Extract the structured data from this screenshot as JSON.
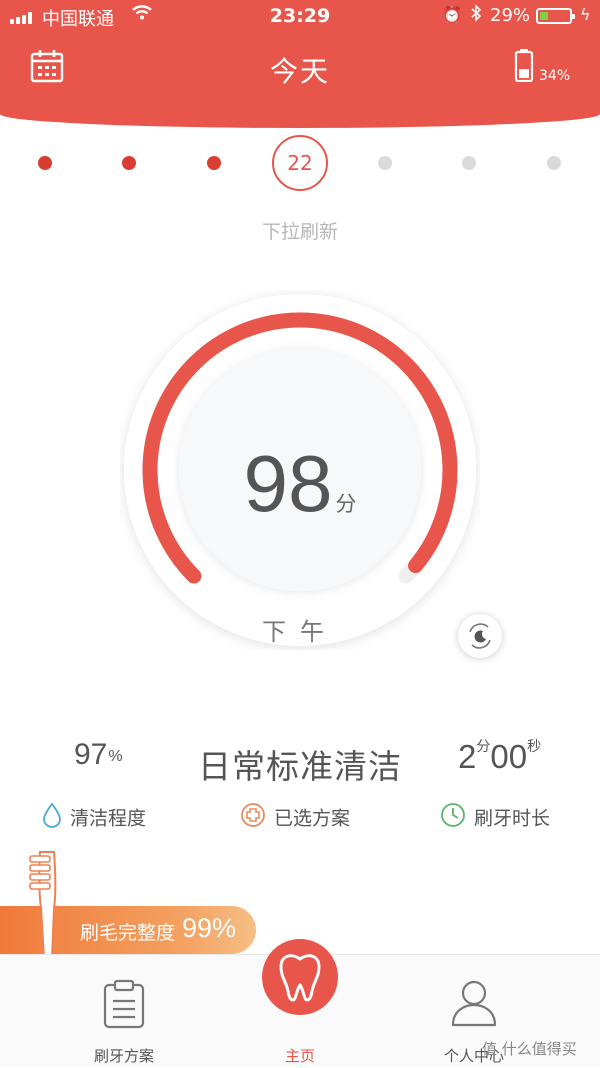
{
  "status_bar": {
    "carrier": "中国联通",
    "time": "23:29",
    "battery_percent": "29%",
    "battery_level": 0.29,
    "battery_color": "#7ed04b"
  },
  "header": {
    "title": "今天",
    "calendar_icon": "calendar-icon",
    "device_battery_icon": "toothbrush-battery-icon",
    "device_battery_percent": "34%",
    "device_battery_level": 0.34,
    "background": "#e8554a"
  },
  "week_strip": {
    "selected_day": "22",
    "days_done": 3,
    "days_upcoming": 3,
    "done_color": "#d93d31",
    "upcoming_color": "#dadada"
  },
  "pull_to_refresh": "下拉刷新",
  "score_gauge": {
    "score": "98",
    "unit": "分",
    "score_fraction": 0.98,
    "period": "下午",
    "arc_color": "#e8554a",
    "night_mode_icon": "moon-refresh-icon"
  },
  "stats": {
    "clean_value": "97",
    "clean_unit": "%",
    "plan_name": "日常标准清洁",
    "duration_min": "2",
    "duration_min_unit": "分",
    "duration_sec": "00",
    "duration_sec_unit": "秒",
    "labels": {
      "clean": "清洁程度",
      "plan": "已选方案",
      "duration": "刷牙时长"
    }
  },
  "brush_head": {
    "label": "刷毛完整度",
    "percent": "99%",
    "icon": "toothbrush-icon"
  },
  "tab_bar": {
    "tabs": [
      {
        "label": "刷牙方案",
        "icon": "clipboard-icon"
      },
      {
        "label": "主页",
        "icon": "tooth-icon"
      },
      {
        "label": "个人中心",
        "icon": "person-icon"
      }
    ],
    "active_index": 1
  },
  "watermark": "值 什么值得买"
}
